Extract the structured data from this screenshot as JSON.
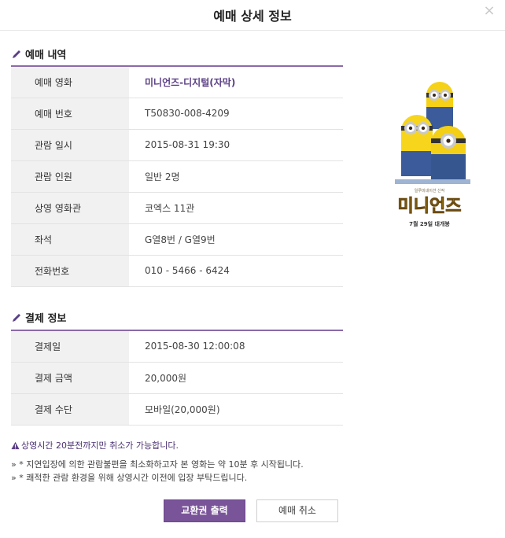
{
  "modal": {
    "title": "예매 상세 정보",
    "close_label": "×"
  },
  "booking_section": {
    "title": "예매 내역",
    "rows": [
      {
        "label": "예매 영화",
        "value": "미니언즈-디지털(자막)"
      },
      {
        "label": "예매 번호",
        "value": "T50830-008-4209"
      },
      {
        "label": "관람 일시",
        "value": "2015-08-31 19:30"
      },
      {
        "label": "관람 인원",
        "value": "일반 2명"
      },
      {
        "label": "상영 영화관",
        "value": "코엑스 11관"
      },
      {
        "label": "좌석",
        "value": "G열8번 / G열9번"
      },
      {
        "label": "전화번호",
        "value": "010 - 5466 - 6424"
      }
    ]
  },
  "payment_section": {
    "title": "결제 정보",
    "rows": [
      {
        "label": "결제일",
        "value": "2015-08-30 12:00:08"
      },
      {
        "label": "결제 금액",
        "value": "20,000원"
      },
      {
        "label": "결제 수단",
        "value": "모바일(20,000원)"
      }
    ]
  },
  "poster": {
    "title_text": "미니언즈",
    "tagline": "일루미네이션 신작",
    "release": "7월 29일 대개봉"
  },
  "notices": {
    "warning": "상영시간 20분전까지만 취소가 가능합니다.",
    "line1": "» * 지연입장에 의한 관람불편을 최소화하고자 본 영화는 약 10분 후 시작됩니다.",
    "line2": "» * 쾌적한 관람 환경을 위해 상영시간 이전에 입장 부탁드립니다."
  },
  "buttons": {
    "print_label": "교환권 출력",
    "cancel_label": "예매 취소"
  },
  "colors": {
    "accent": "#7a5499",
    "table_header_bg": "#f1f1f1"
  }
}
